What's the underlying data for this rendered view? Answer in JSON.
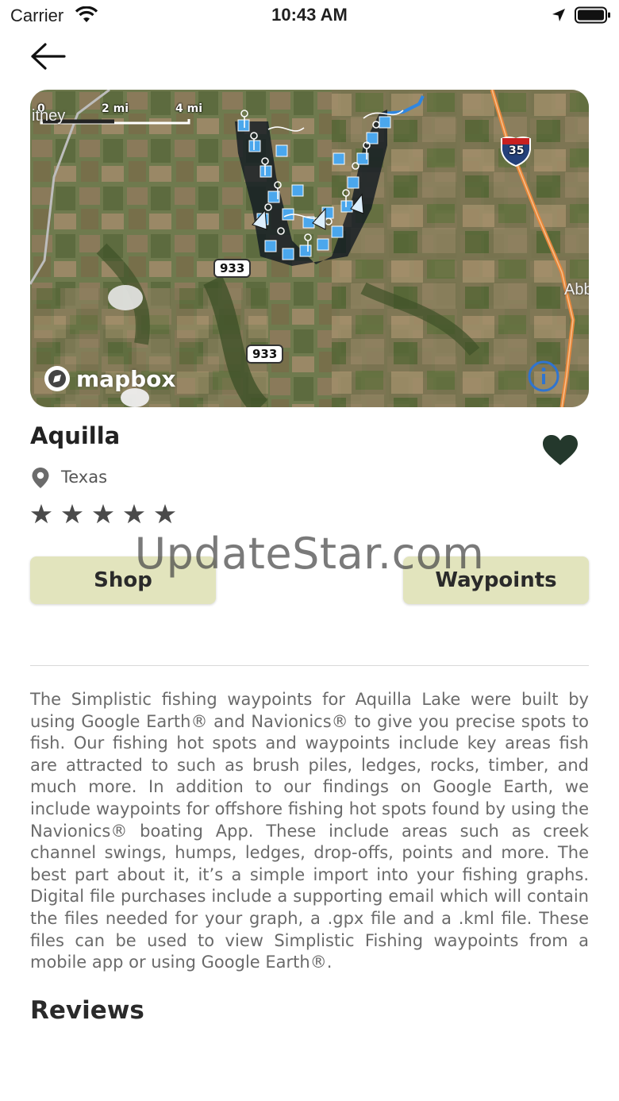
{
  "status_bar": {
    "carrier": "Carrier",
    "time": "10:43 AM"
  },
  "map": {
    "scale_labels": [
      "0",
      "2 mi",
      "4 mi"
    ],
    "town_left": "itney",
    "town_right": "Abb",
    "road_badge_1": "933",
    "road_badge_2": "933",
    "interstate": "35",
    "attribution": "mapbox"
  },
  "lake": {
    "name": "Aquilla",
    "state": "Texas",
    "rating_stars": 5,
    "favorited": true
  },
  "buttons": {
    "shop": "Shop",
    "waypoints": "Waypoints"
  },
  "watermark": "UpdateStar.com",
  "description": "The Simplistic fishing waypoints for Aquilla Lake were built by using Google Earth® and Navionics® to give you precise spots to fish. Our fishing hot spots and waypoints include key areas fish are attracted to such as brush piles, ledges, rocks, timber, and much more. In addition to our findings on Google Earth, we include waypoints for offshore fishing hot spots found by using the Navionics® boating App. These include areas such as creek channel swings, humps, ledges, drop-offs, points and more. The best part about it, it’s a simple import into your fishing graphs. Digital file purchases include a supporting email which will contain the files needed for your graph, a .gpx file and a .kml file. These files can be used to view Simplistic Fishing waypoints from a mobile app or using Google Earth®.",
  "reviews_heading": "Reviews",
  "colors": {
    "button_bg": "#e2e4bd",
    "heart": "#24382c",
    "waypoint_blue": "#3a9ae8",
    "highway_orange": "#e8873a"
  }
}
